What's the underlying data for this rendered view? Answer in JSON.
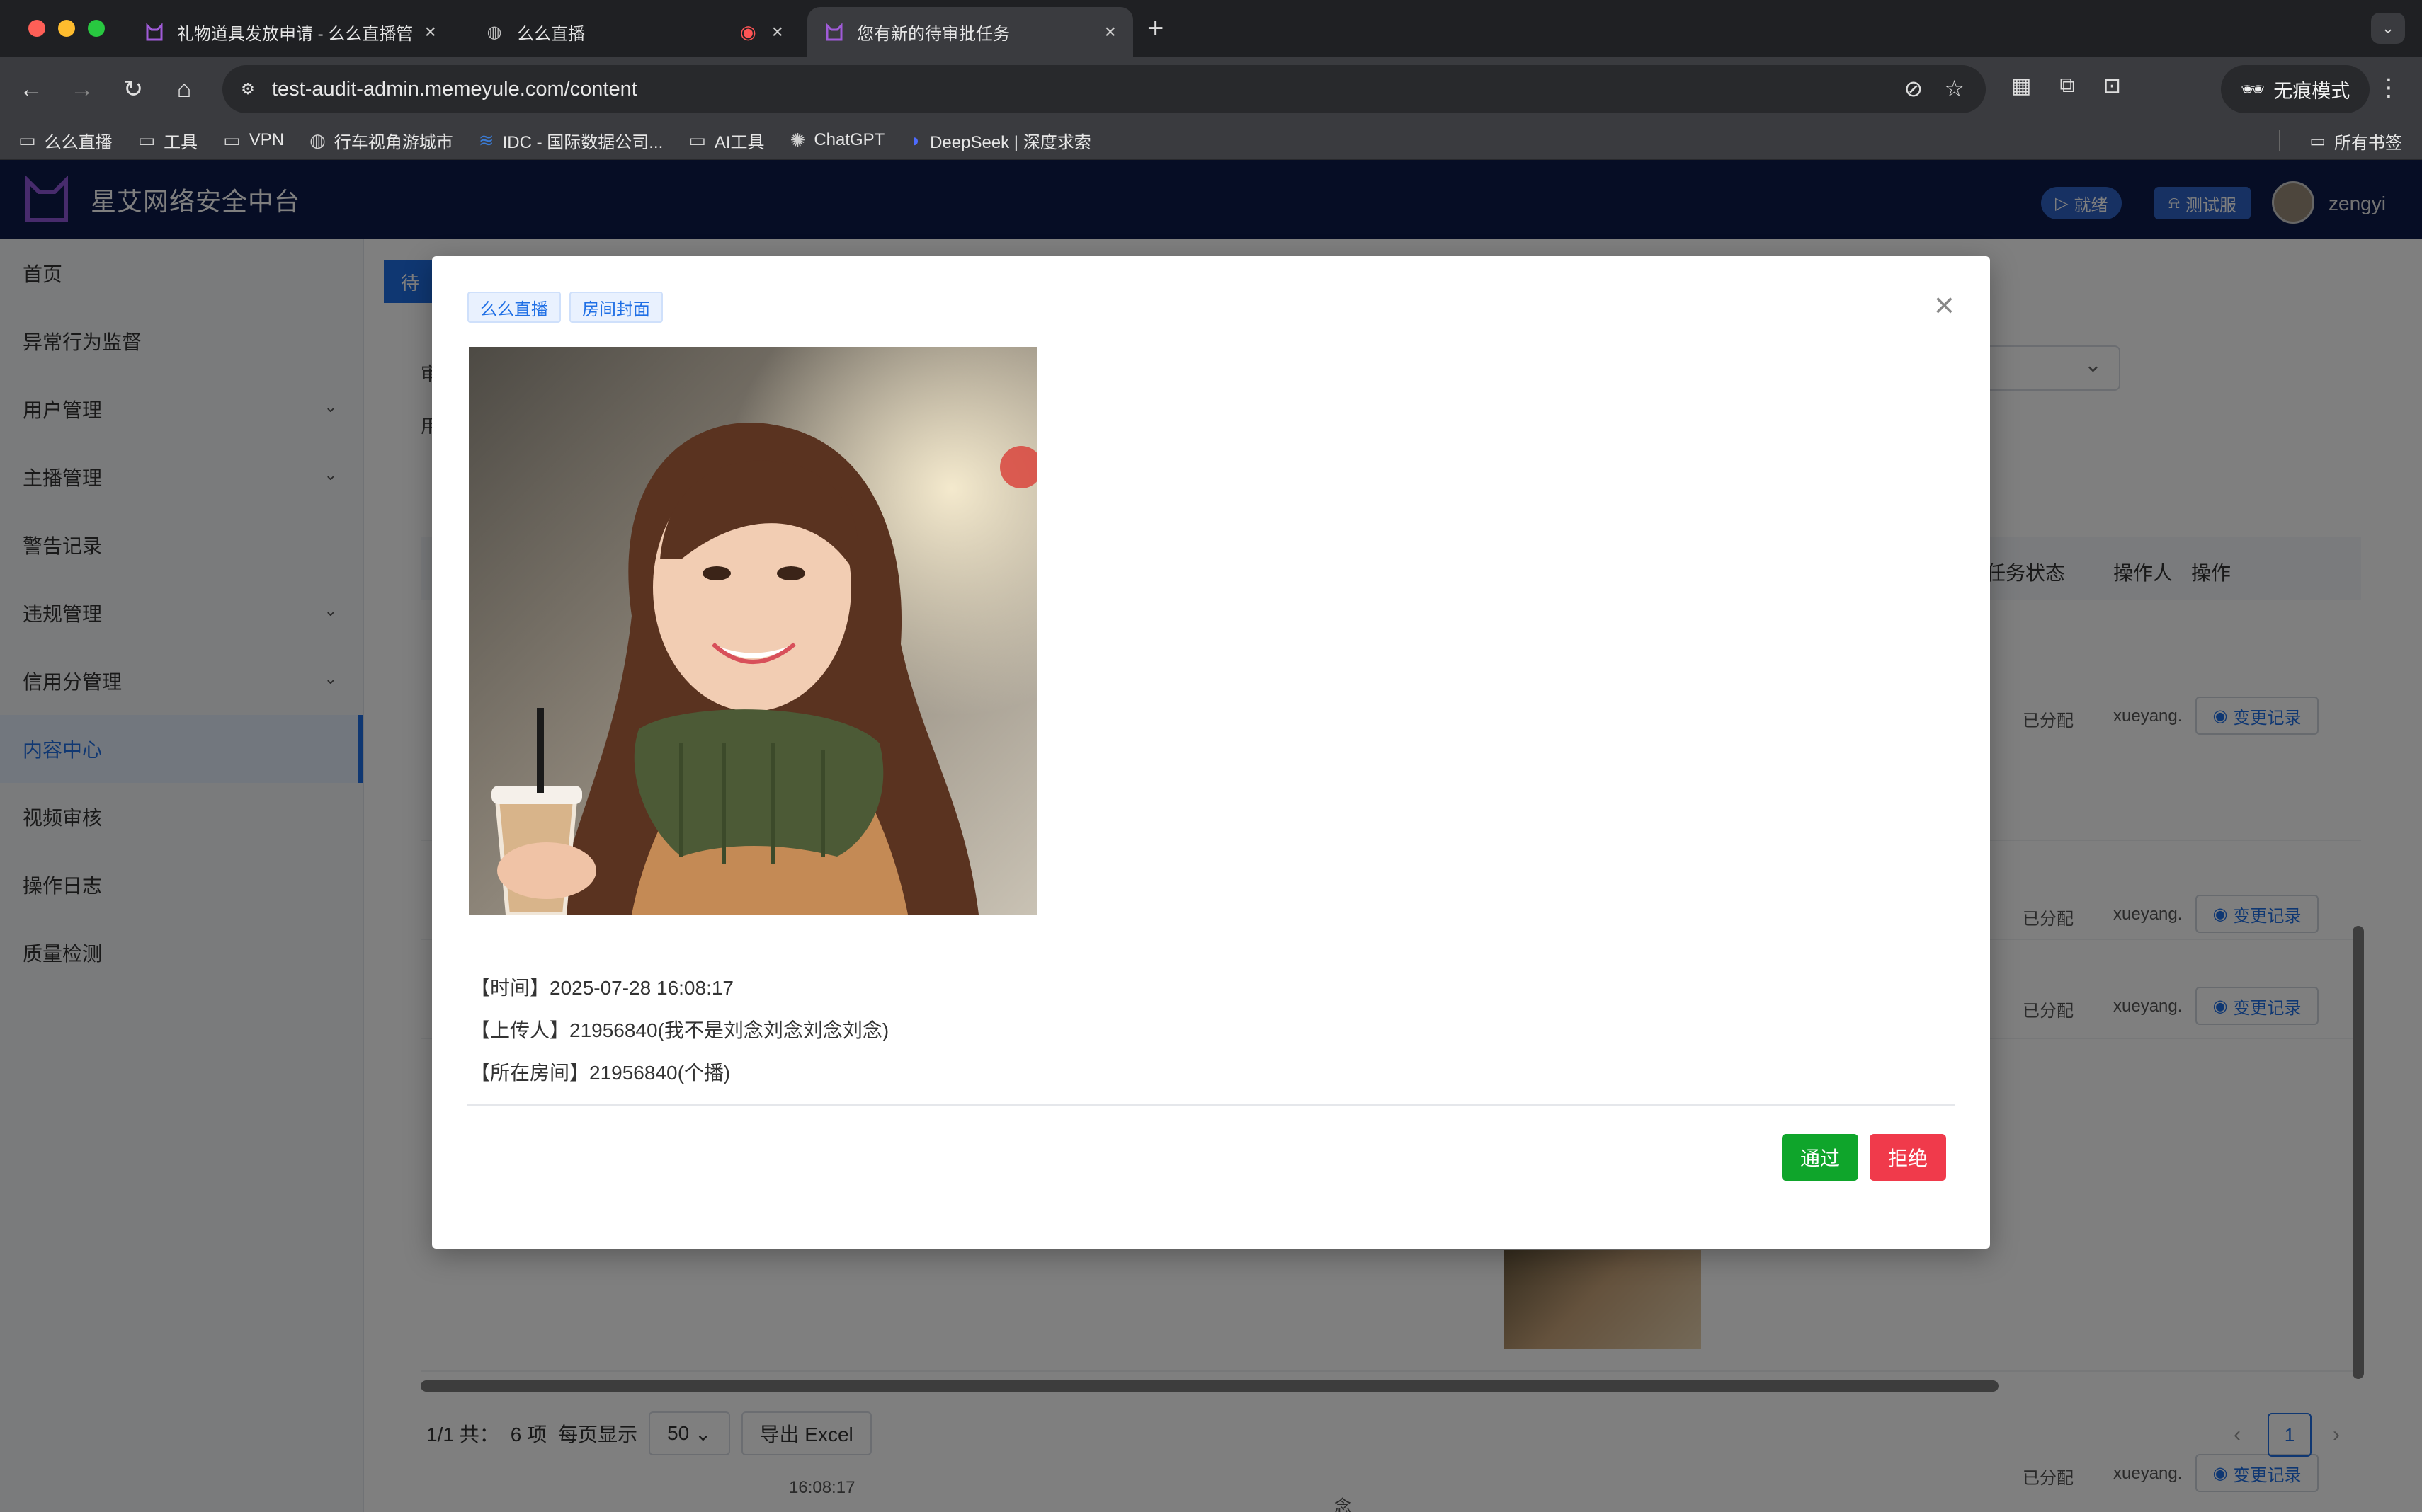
{
  "browser": {
    "tabs": [
      {
        "title": "礼物道具发放申请 - 么么直播管"
      },
      {
        "title": "么么直播"
      },
      {
        "title": "您有新的待审批任务"
      }
    ],
    "url": "test-audit-admin.memeyule.com/content",
    "incognito_label": "无痕模式",
    "bookmarks": [
      {
        "label": "么么直播",
        "icon": "folder-icon"
      },
      {
        "label": "工具",
        "icon": "folder-icon"
      },
      {
        "label": "VPN",
        "icon": "folder-icon"
      },
      {
        "label": "行车视角游城市",
        "icon": "globe-icon"
      },
      {
        "label": "IDC - 国际数据公司...",
        "icon": "idc-icon"
      },
      {
        "label": "AI工具",
        "icon": "folder-icon"
      },
      {
        "label": "ChatGPT",
        "icon": "chatgpt-icon"
      },
      {
        "label": "DeepSeek | 深度求索",
        "icon": "deepseek-icon"
      }
    ],
    "all_bookmarks_label": "所有书签"
  },
  "app": {
    "title": "星艾网络安全中台",
    "status_pill": "就绪",
    "env_pill": "测试服",
    "username": "zengyi",
    "accent": "#1f6fe5",
    "header_bg": "#0c1a4b"
  },
  "sidebar": {
    "items": [
      {
        "label": "首页"
      },
      {
        "label": "异常行为监督"
      },
      {
        "label": "用户管理"
      },
      {
        "label": "主播管理"
      },
      {
        "label": "警告记录"
      },
      {
        "label": "违规管理"
      },
      {
        "label": "信用分管理"
      },
      {
        "label": "内容中心"
      },
      {
        "label": "视频审核"
      },
      {
        "label": "操作日志"
      },
      {
        "label": "质量检测"
      }
    ]
  },
  "content": {
    "tab_fragment": "待",
    "filter_fragment_1": "审",
    "filter_fragment_2": "用",
    "columns": {
      "task_status": "任务状态",
      "operator": "操作人",
      "action": "操作"
    },
    "rows": [
      {
        "status": "已分配",
        "operator": "xueyang.",
        "action": "变更记录"
      },
      {
        "status": "已分配",
        "operator": "xueyang.",
        "action": "变更记录"
      },
      {
        "status": "已分配",
        "operator": "xueyang.",
        "action": "变更记录"
      },
      {
        "status": "已分配",
        "operator": "xueyang.",
        "action": "变更记录"
      }
    ],
    "time_fragment": "16:08:17",
    "name_fragment": "念",
    "pager": {
      "summary": "1/1 共：",
      "count": "6 项",
      "per_page_label": "每页显示",
      "per_page": "50",
      "export": "导出 Excel",
      "current_page": "1"
    }
  },
  "modal": {
    "tags": [
      "么么直播",
      "房间封面"
    ],
    "time_line": "【时间】2025-07-28 16:08:17",
    "uploader_line": "【上传人】21956840(我不是刘念刘念刘念刘念)",
    "room_line": "【所在房间】21956840(个播)",
    "approve": "通过",
    "reject": "拒绝",
    "approve_color": "#0fa52b",
    "reject_color": "#f03a4b"
  }
}
